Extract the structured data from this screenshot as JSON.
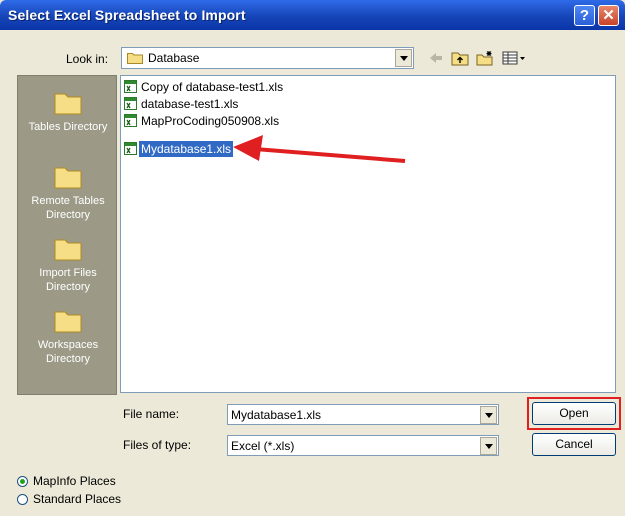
{
  "window": {
    "title": "Select Excel Spreadsheet to Import",
    "help_label": "?",
    "close_label": "✕"
  },
  "lookin": {
    "label": "Look in:",
    "value": "Database"
  },
  "places": [
    {
      "label": "Tables Directory"
    },
    {
      "label": "Remote Tables Directory"
    },
    {
      "label": "Import Files Directory"
    },
    {
      "label": "Workspaces Directory"
    }
  ],
  "files": [
    {
      "name": "Copy of database-test1.xls",
      "selected": false
    },
    {
      "name": "database-test1.xls",
      "selected": false
    },
    {
      "name": "MapProCoding050908.xls",
      "selected": false
    },
    {
      "name": "Mydatabase1.xls",
      "selected": true
    }
  ],
  "filename": {
    "label": "File name:",
    "value": "Mydatabase1.xls"
  },
  "filetype": {
    "label": "Files of type:",
    "value": "Excel (*.xls)"
  },
  "buttons": {
    "open": "Open",
    "cancel": "Cancel"
  },
  "radios": [
    {
      "label": "MapInfo Places",
      "checked": true
    },
    {
      "label": "Standard Places",
      "checked": false
    }
  ],
  "colors": {
    "title_bar": "#1645B8",
    "dialog_bg": "#ECE9D8",
    "places_bg": "#9C9A87",
    "selection": "#316AC5",
    "annotation": "#E02020"
  }
}
